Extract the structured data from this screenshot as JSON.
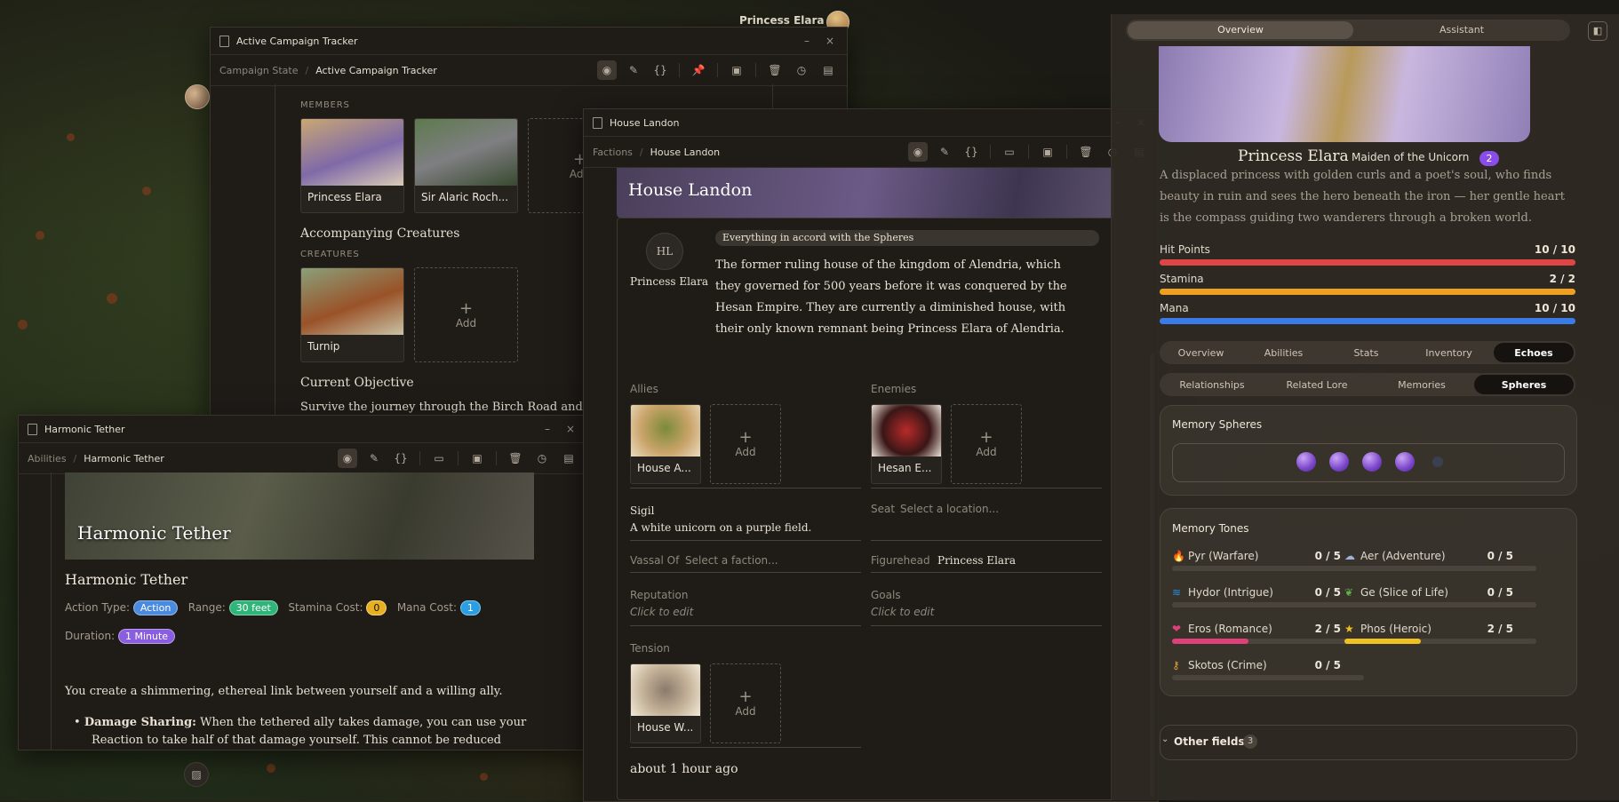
{
  "top_user": {
    "name": "Princess Elara"
  },
  "campaign_window": {
    "title": "Active Campaign Tracker",
    "crumb_parent": "Campaign State",
    "crumb_current": "Active Campaign Tracker",
    "members_label": "MEMBERS",
    "members": [
      "Princess Elara",
      "Sir Alaric Roch..."
    ],
    "add_label": "Add",
    "creatures_heading": "Accompanying Creatures",
    "creatures_label": "CREATURES",
    "creatures": [
      "Turnip"
    ],
    "objective_heading": "Current Objective",
    "objective_text": "Survive the journey through the Birch Road and"
  },
  "ability_window": {
    "title": "Harmonic Tether",
    "crumb_parent": "Abilities",
    "crumb_current": "Harmonic Tether",
    "banner_title": "Harmonic Tether",
    "heading": "Harmonic Tether",
    "action_type_label": "Action Type:",
    "action_type": "Action",
    "range_label": "Range:",
    "range": "30 feet",
    "stamina_cost_label": "Stamina Cost:",
    "stamina_cost": "0",
    "mana_cost_label": "Mana Cost:",
    "mana_cost": "1",
    "duration_label": "Duration:",
    "duration": "1 Minute",
    "description": "You create a shimmering, ethereal link between yourself and a willing ally.",
    "bullet_bold": "Damage Sharing:",
    "bullet_text": "When the tethered ally takes damage, you can use your",
    "bullet_text2": "Reaction to take half of that damage yourself. This cannot be reduced"
  },
  "faction_window": {
    "title": "House Landon",
    "crumb_parent": "Factions",
    "crumb_current": "House Landon",
    "banner_title": "House Landon",
    "avatar_initials": "HL",
    "leader_name": "Princess Elara",
    "motto": "Everything in accord with the Spheres",
    "description": "The former ruling house of the kingdom of Alendria, which they governed for 500 years before it was conquered by the Hesan Empire. They are currently a diminished house, with their only known remnant being Princess Elara of Alendria.",
    "allies_label": "Allies",
    "allies": [
      "House A..."
    ],
    "enemies_label": "Enemies",
    "enemies": [
      "Hesan E..."
    ],
    "add_label": "Add",
    "sigil_label": "Sigil",
    "sigil_value": "A white unicorn on a purple field.",
    "seat_label": "Seat",
    "seat_placeholder": "Select a location...",
    "vassal_label": "Vassal Of",
    "vassal_placeholder": "Select a faction...",
    "figurehead_label": "Figurehead",
    "figurehead_value": "Princess Elara",
    "reputation_label": "Reputation",
    "reputation_placeholder": "Click to edit",
    "goals_label": "Goals",
    "goals_placeholder": "Click to edit",
    "tension_label": "Tension",
    "tension": [
      "House W..."
    ],
    "timestamp": "about 1 hour ago"
  },
  "right_panel": {
    "tabs": [
      "Overview",
      "Assistant"
    ],
    "name": "Princess Elara",
    "subtitle": "Maiden of the Unicorn",
    "badge": "2",
    "bio": "A displaced princess with golden curls and a poet's soul, who finds beauty in ruin and sees the hero beneath the iron — her gentle heart is the compass guiding two wanderers through a broken world.",
    "stats": [
      {
        "label": "Hit Points",
        "value": "10 / 10",
        "fraction": 1.0,
        "color": "#e04545"
      },
      {
        "label": "Stamina",
        "value": "2 / 2",
        "fraction": 1.0,
        "color": "#f0a020"
      },
      {
        "label": "Mana",
        "value": "10 / 10",
        "fraction": 1.0,
        "color": "#3a7be8"
      }
    ],
    "subtabs1": [
      "Overview",
      "Abilities",
      "Stats",
      "Inventory",
      "Echoes"
    ],
    "subtabs2": [
      "Relationships",
      "Related Lore",
      "Memories",
      "Spheres"
    ],
    "spheres_title": "Memory Spheres",
    "spheres_filled": 4,
    "spheres_total": 5,
    "tones_title": "Memory Tones",
    "tones": [
      {
        "label": "Pyr (Warfare)",
        "value": "0 / 5",
        "fraction": 0,
        "color": "#e05a2a",
        "icon": "fire-icon"
      },
      {
        "label": "Aer (Adventure)",
        "value": "0 / 5",
        "fraction": 0,
        "color": "#9fb4d8",
        "icon": "wind-icon"
      },
      {
        "label": "Hydor (Intrigue)",
        "value": "0 / 5",
        "fraction": 0,
        "color": "#2a8fe0",
        "icon": "wave-icon"
      },
      {
        "label": "Ge (Slice of Life)",
        "value": "0 / 5",
        "fraction": 0,
        "color": "#5fb04a",
        "icon": "leaf-icon"
      },
      {
        "label": "Eros (Romance)",
        "value": "2 / 5",
        "fraction": 0.4,
        "color": "#e0407a",
        "icon": "heart-icon"
      },
      {
        "label": "Phos (Heroic)",
        "value": "2 / 5",
        "fraction": 0.4,
        "color": "#f0c020",
        "icon": "star-icon"
      },
      {
        "label": "Skotos (Crime)",
        "value": "0 / 5",
        "fraction": 0,
        "color": "#e0a030",
        "icon": "key-icon"
      }
    ],
    "other_fields_label": "Other fields",
    "other_fields_count": "3"
  }
}
